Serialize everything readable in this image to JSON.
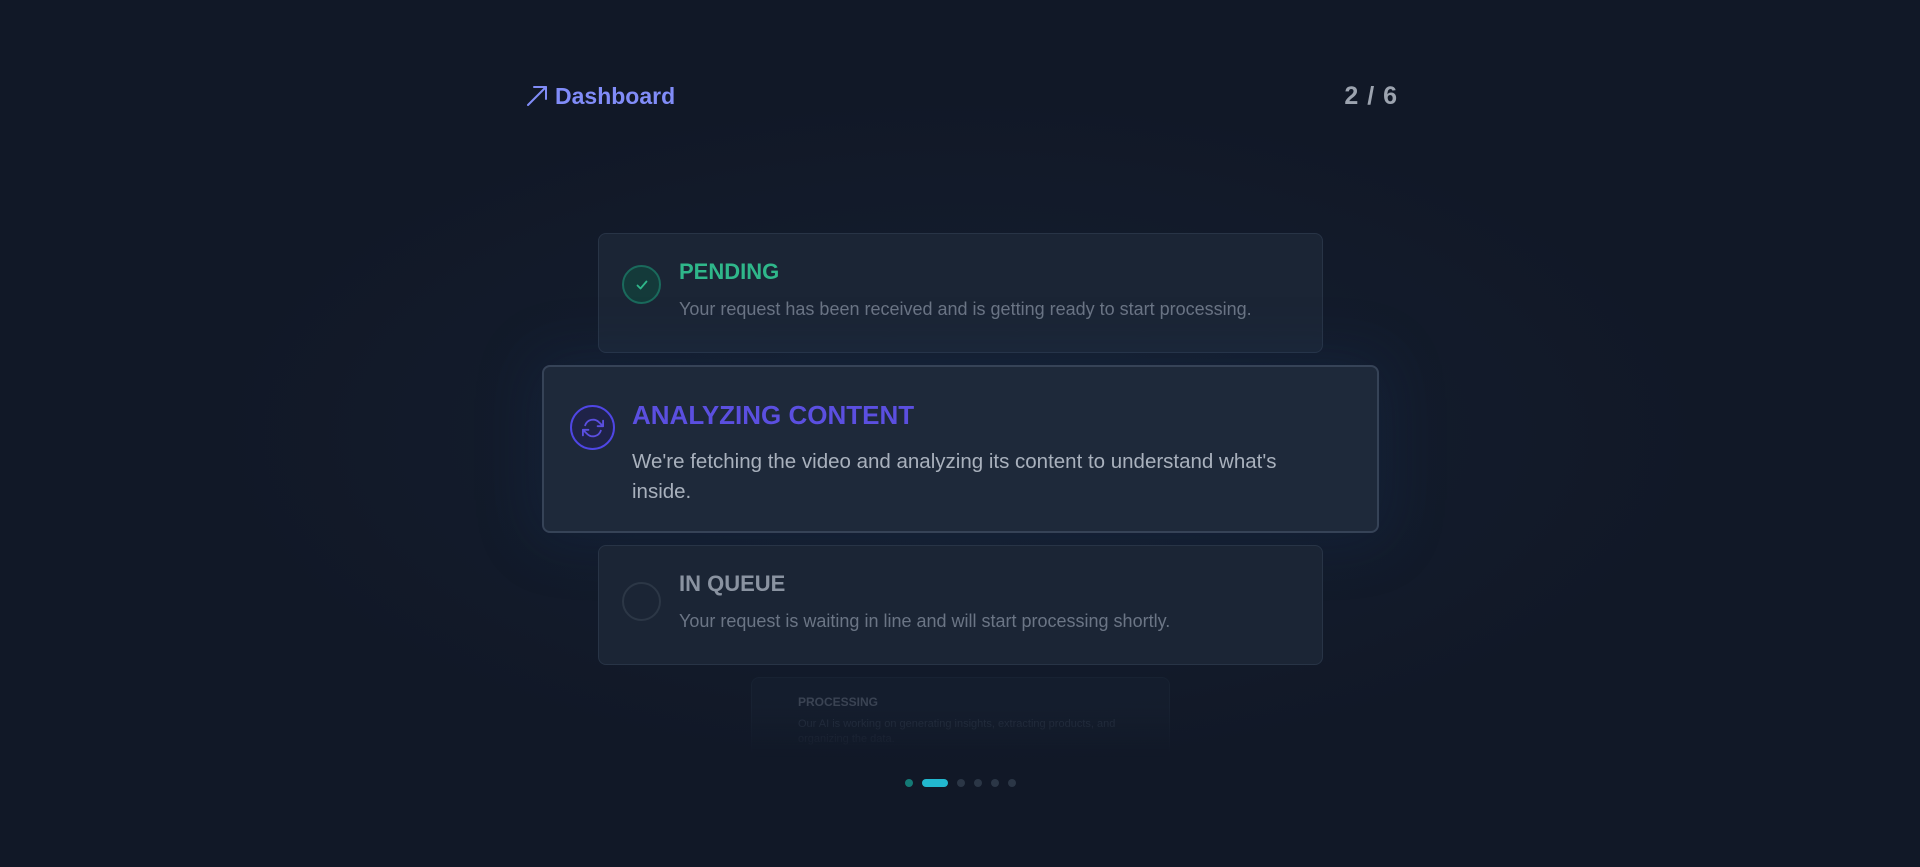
{
  "header": {
    "link_label": "Dashboard",
    "link_icon": "arrow-up-right-icon",
    "step_counter": "2 / 6"
  },
  "steps": [
    {
      "title": "PENDING",
      "description": "Your request has been received and is getting ready to start processing.",
      "status": "completed",
      "icon": "check-icon",
      "color": "#2fb78a"
    },
    {
      "title": "ANALYZING CONTENT",
      "description": "We're fetching the video and analyzing its content to understand what's inside.",
      "status": "active",
      "icon": "refresh-icon",
      "color": "#5b4fe0"
    },
    {
      "title": "IN QUEUE",
      "description": "Your request is waiting in line and will start processing shortly.",
      "status": "upcoming",
      "icon": "empty-circle-icon",
      "color": "#8a93a1"
    },
    {
      "title": "PROCESSING",
      "description": "Our AI is working on generating insights, extracting products, and organizing the data.",
      "status": "upcoming",
      "icon": "empty-circle-icon",
      "color": "#5c6676"
    }
  ],
  "pagination": {
    "total": 6,
    "current": 2,
    "accent_color": "#22b8cf"
  }
}
